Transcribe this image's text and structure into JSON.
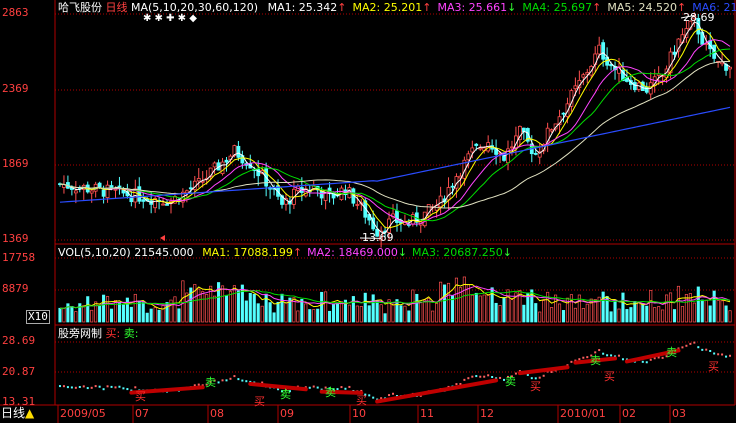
{
  "colors": {
    "bg": "#000000",
    "axis_red": "#b00000",
    "up": "#ff5050",
    "down": "#54ffff",
    "ma1": "#ffffff",
    "ma2": "#ffff00",
    "ma3": "#ff44ff",
    "ma4": "#00dd00",
    "ma5": "#e0e0c0",
    "ma6": "#2a4cff",
    "y_label": "#ff4040",
    "buy": "#ff3030",
    "sell": "#30ff30",
    "trend": "#c00000"
  },
  "price_panel": {
    "stock_name": "哈飞股份",
    "period": "日线",
    "ma_params": "MA(5,10,20,30,60,120)",
    "markers": "✱ ✱            ✚            ✱  ◆",
    "ma_readouts": [
      {
        "label": "MA1:",
        "value": "25.342",
        "arrow": "↑",
        "color": "#ffffff"
      },
      {
        "label": "MA2:",
        "value": "25.201",
        "arrow": "↑",
        "color": "#ffff00"
      },
      {
        "label": "MA3:",
        "value": "25.661",
        "arrow": "↓",
        "color": "#ff44ff"
      },
      {
        "label": "MA4:",
        "value": "25.697",
        "arrow": "↑",
        "color": "#00dd00"
      },
      {
        "label": "MA5:",
        "value": "24.520",
        "arrow": "↑",
        "color": "#e0e0c0"
      },
      {
        "label": "MA6:",
        "value": "21.0",
        "arrow": "",
        "color": "#2a4cff"
      }
    ],
    "y_ticks": [
      "2863",
      "2369",
      "1869",
      "1369"
    ],
    "high_label": "28.69",
    "low_label": "13.69"
  },
  "volume_panel": {
    "params": "VOL(5,10,20)",
    "current": "21545.000",
    "ma_readouts": [
      {
        "label": "MA1:",
        "value": "17088.199",
        "arrow": "↑",
        "color": "#ffff00"
      },
      {
        "label": "MA2:",
        "value": "18469.000",
        "arrow": "↓",
        "color": "#ff44ff"
      },
      {
        "label": "MA3:",
        "value": "20687.250",
        "arrow": "↓",
        "color": "#00dd00"
      }
    ],
    "y_ticks": [
      "17758",
      "8879",
      "X10"
    ]
  },
  "signal_panel": {
    "title": "股旁网制",
    "buy_label": "买:",
    "sell_label": "卖:",
    "y_ticks": [
      "28.69",
      "20.87",
      "13.31"
    ],
    "buy_char": "买",
    "sell_char": "卖"
  },
  "bottom_bar": {
    "period_button": "日线",
    "dates": [
      "2009/05",
      "07",
      "08",
      "09",
      "10",
      "11",
      "12",
      "2010/01",
      "02",
      "03"
    ]
  },
  "chart_data": {
    "type": "candlestick",
    "series": [
      {
        "name": "MA1"
      },
      {
        "name": "MA2"
      },
      {
        "name": "MA3"
      },
      {
        "name": "MA4"
      },
      {
        "name": "MA5"
      },
      {
        "name": "MA6"
      }
    ],
    "high": 28.69,
    "low": 13.69
  }
}
